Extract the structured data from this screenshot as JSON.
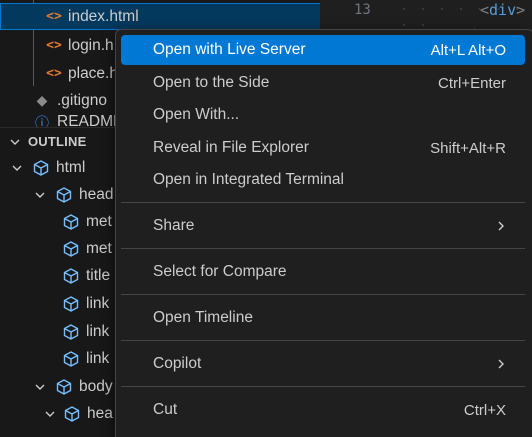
{
  "explorer": {
    "files": [
      {
        "name": "index.html",
        "icon": "html-icon",
        "selected": true
      },
      {
        "name": "login.h",
        "icon": "html-icon"
      },
      {
        "name": "place.h",
        "icon": "html-icon"
      },
      {
        "name": ".gitigno",
        "icon": "git-icon"
      },
      {
        "name": "README",
        "icon": "info-icon"
      }
    ]
  },
  "outline": {
    "header": "OUTLINE",
    "items": [
      {
        "label": "html",
        "expanded": true
      },
      {
        "label": "head",
        "expanded": true
      },
      {
        "label": "met"
      },
      {
        "label": "met"
      },
      {
        "label": "title"
      },
      {
        "label": "link"
      },
      {
        "label": "link"
      },
      {
        "label": "link"
      },
      {
        "label": "body",
        "expanded": true
      },
      {
        "label": "hea",
        "expanded": true
      }
    ]
  },
  "editor": {
    "line_number": "13",
    "code_open": "<",
    "code_tag": "div",
    "code_close": ">"
  },
  "context_menu": {
    "items": [
      {
        "label": "Open with Live Server",
        "shortcut": "Alt+L Alt+O",
        "active": true
      },
      {
        "label": "Open to the Side",
        "shortcut": "Ctrl+Enter"
      },
      {
        "label": "Open With...",
        "shortcut": ""
      },
      {
        "label": "Reveal in File Explorer",
        "shortcut": "Shift+Alt+R"
      },
      {
        "label": "Open in Integrated Terminal",
        "shortcut": ""
      },
      {
        "label": "Share",
        "submenu": true
      },
      {
        "label": "Select for Compare",
        "shortcut": ""
      },
      {
        "label": "Open Timeline",
        "shortcut": ""
      },
      {
        "label": "Copilot",
        "submenu": true
      },
      {
        "label": "Cut",
        "shortcut": "Ctrl+X"
      }
    ]
  },
  "colors": {
    "accent": "#0078d4",
    "html_icon": "#e37933",
    "outline_icon": "#75beff",
    "tag_name": "#569cd6"
  }
}
